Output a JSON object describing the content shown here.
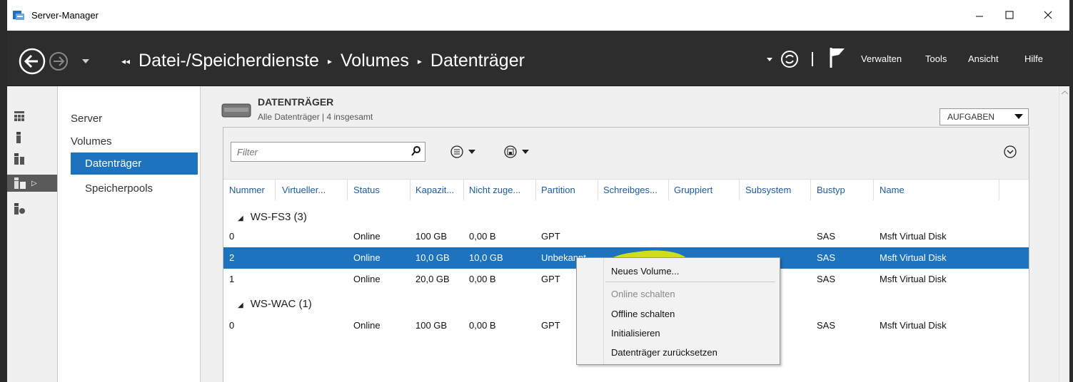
{
  "window": {
    "title": "Server-Manager"
  },
  "header": {
    "breadcrumb": [
      "Datei-/Speicherdienste",
      "Volumes",
      "Datenträger"
    ],
    "menu": [
      "Verwalten",
      "Tools",
      "Ansicht",
      "Hilfe"
    ]
  },
  "nav": {
    "items": [
      "Server",
      "Volumes",
      "Datenträger",
      "Speicherpools"
    ]
  },
  "section": {
    "title": "DATENTRÄGER",
    "subtitle": "Alle Datenträger | 4 insgesamt",
    "tasks_label": "AUFGABEN"
  },
  "filter": {
    "placeholder": "Filter"
  },
  "columns": [
    "Nummer",
    "Virtueller...",
    "Status",
    "Kapazit...",
    "Nicht zuge...",
    "Partition",
    "Schreibges...",
    "Gruppiert",
    "Subsystem",
    "Bustyp",
    "Name"
  ],
  "groups": [
    {
      "label": "WS-FS3 (3)",
      "rows": [
        {
          "number": "0",
          "status": "Online",
          "capacity": "100 GB",
          "unallocated": "0,00 B",
          "partition": "GPT",
          "bus": "SAS",
          "name": "Msft Virtual Disk"
        },
        {
          "number": "2",
          "status": "Online",
          "capacity": "10,0 GB",
          "unallocated": "10,0 GB",
          "partition": "Unbekannt",
          "bus": "SAS",
          "name": "Msft Virtual Disk"
        },
        {
          "number": "1",
          "status": "Online",
          "capacity": "20,0 GB",
          "unallocated": "0,00 B",
          "partition": "GPT",
          "bus": "SAS",
          "name": "Msft Virtual Disk"
        }
      ]
    },
    {
      "label": "WS-WAC (1)",
      "rows": [
        {
          "number": "0",
          "status": "Online",
          "capacity": "100 GB",
          "unallocated": "0,00 B",
          "partition": "GPT",
          "bus": "SAS",
          "name": "Msft Virtual Disk"
        }
      ]
    }
  ],
  "context_menu": {
    "items": [
      "Neues Volume...",
      "Online schalten",
      "Offline schalten",
      "Initialisieren",
      "Datenträger zurücksetzen"
    ]
  },
  "colors": {
    "selection": "#1e73be",
    "header_bg": "#2d2d2d",
    "highlight": "#f0f000"
  }
}
